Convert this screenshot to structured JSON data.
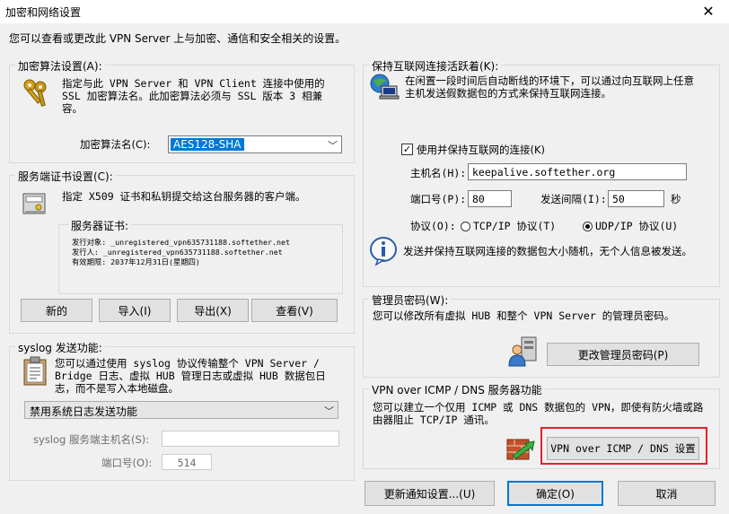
{
  "window": {
    "title": "加密和网络设置",
    "close_glyph": "✕"
  },
  "description": "您可以查看或更改此 VPN Server 上与加密、通信和安全相关的设置。",
  "encryption": {
    "legend": "加密算法设置(A):",
    "text": "指定与此 VPN Server 和 VPN Client 连接中使用的 SSL 加密算法名。此加密算法必须与 SSL 版本 3 相兼容。",
    "algo_label": "加密算法名(C):",
    "algo_value": "AES128-SHA",
    "icon": "keys-icon"
  },
  "server_cert": {
    "legend": "服务端证书设置(C):",
    "text": "指定 X509 证书和私钥提交给这台服务器的客户端。",
    "cert_legend": "服务器证书:",
    "cert_lines": [
      "发行对象: _unregistered_vpn635731188.softether.net",
      "发行人: _unregistered_vpn635731188.softether.net",
      "有效期限: 2037年12月31日(星期四)"
    ],
    "buttons": {
      "new": "新的",
      "import": "导入(I)",
      "export": "导出(X)",
      "view": "查看(V)"
    },
    "icon": "certificate-server-icon"
  },
  "syslog": {
    "legend": "syslog 发送功能:",
    "text": "您可以通过使用 syslog 协议传输整个 VPN Server / Bridge 日志、虚拟 HUB 管理日志或虚拟 HUB 数据包日志，而不是写入本地磁盘。",
    "mode_value": "禁用系统日志发送功能",
    "host_label": "syslog 服务端主机名(S):",
    "host_value": "",
    "port_label": "端口号(O):",
    "port_value": "514",
    "icon": "clipboard-icon"
  },
  "keepalive": {
    "legend": "保持互联网连接活跃着(K):",
    "text": "在闲置一段时间后自动断线的环境下，可以通过向互联网上任意主机发送假数据包的方式来保持互联网连接。",
    "enable_label": "使用并保持互联网的连接(K)",
    "enabled": true,
    "host_label": "主机名(H):",
    "host_value": "keepalive.softether.org",
    "port_label": "端口号(P):",
    "port_value": "80",
    "interval_label": "发送间隔(I):",
    "interval_value": "50",
    "interval_unit": "秒",
    "protocol_label": "协议(O):",
    "tcp_label": "TCP/IP 协议(T)",
    "udp_label": "UDP/IP 协议(U)",
    "selected_protocol": "udp",
    "info_text": "发送并保持互联网连接的数据包大小随机，无个人信息被发送。",
    "icon": "network-computer-icon",
    "info_icon": "info-icon"
  },
  "admin_password": {
    "legend": "管理员密码(W):",
    "text": "您可以修改所有虚拟 HUB 和整个 VPN Server 的管理员密码。",
    "button": "更改管理员密码(P)",
    "icon": "admin-user-icon"
  },
  "vpn_over_icmp": {
    "legend": "VPN over ICMP / DNS 服务器功能",
    "text": "您可以建立一个仅用 ICMP 或 DNS 数据包的 VPN，即使有防火墙或路由器阻止 TCP/IP 通讯。",
    "button": "VPN over ICMP / DNS 设置",
    "highlight_color": "#e0242d",
    "icon": "firewall-icon"
  },
  "footer": {
    "update_button": "更新通知设置...(U)",
    "ok_button": "确定(O)",
    "cancel_button": "取消"
  }
}
